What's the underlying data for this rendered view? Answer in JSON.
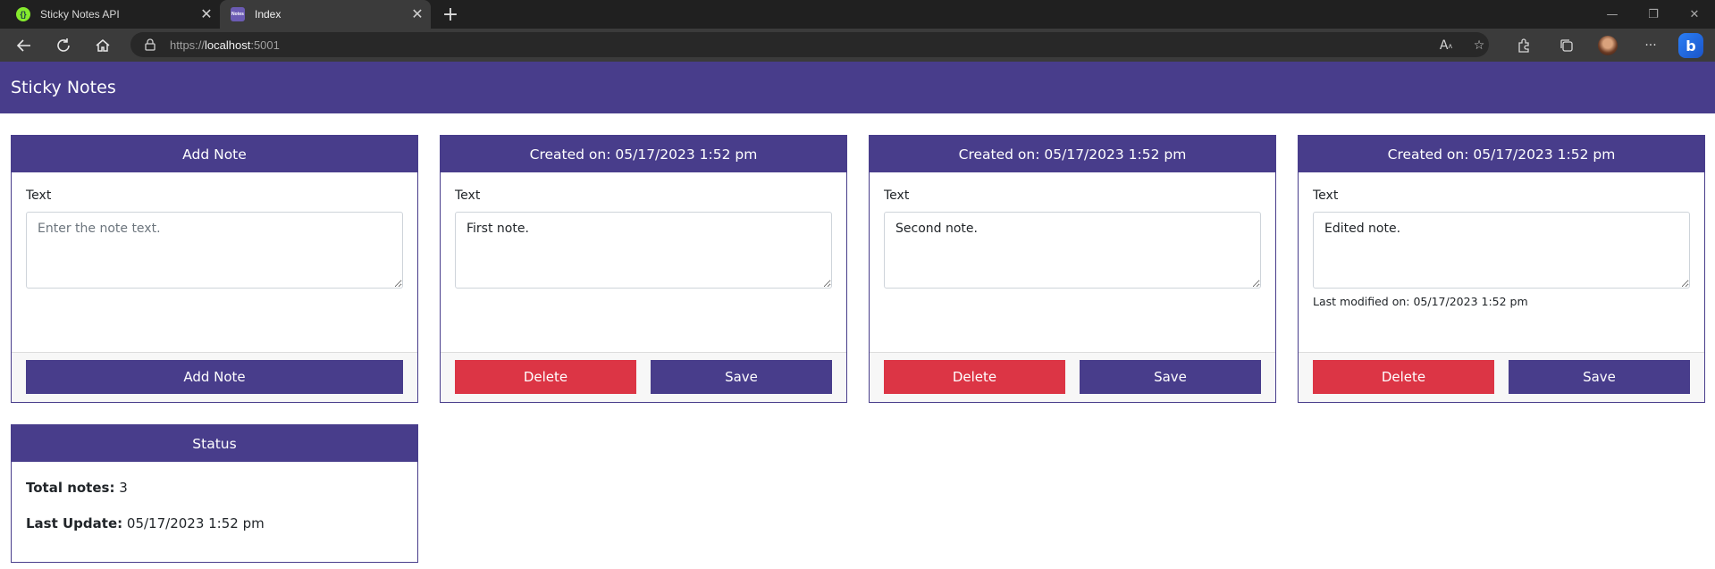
{
  "browser": {
    "tabs": [
      {
        "title": "Sticky Notes API",
        "favicon": "swagger-icon"
      },
      {
        "title": "Index",
        "favicon": "notes-icon",
        "favicon_text": "Notes"
      }
    ],
    "url_prefix": "https://",
    "url_host": "localhost",
    "url_port": ":5001"
  },
  "app": {
    "brand": "Sticky Notes",
    "colors": {
      "primary": "#483d8b",
      "danger": "#dc3545"
    }
  },
  "add_note": {
    "header": "Add Note",
    "label": "Text",
    "placeholder": "Enter the note text.",
    "button": "Add Note"
  },
  "notes": [
    {
      "header": "Created on: 05/17/2023 1:52 pm",
      "label": "Text",
      "text": "First note.",
      "modified": "",
      "delete_label": "Delete",
      "save_label": "Save"
    },
    {
      "header": "Created on: 05/17/2023 1:52 pm",
      "label": "Text",
      "text": "Second note.",
      "modified": "",
      "delete_label": "Delete",
      "save_label": "Save"
    },
    {
      "header": "Created on: 05/17/2023 1:52 pm",
      "label": "Text",
      "text": "Edited note.",
      "modified": "Last modified on: 05/17/2023 1:52 pm",
      "delete_label": "Delete",
      "save_label": "Save"
    }
  ],
  "status": {
    "header": "Status",
    "total_label": "Total notes:",
    "total_value": "3",
    "update_label": "Last Update:",
    "update_value": "05/17/2023 1:52 pm"
  }
}
